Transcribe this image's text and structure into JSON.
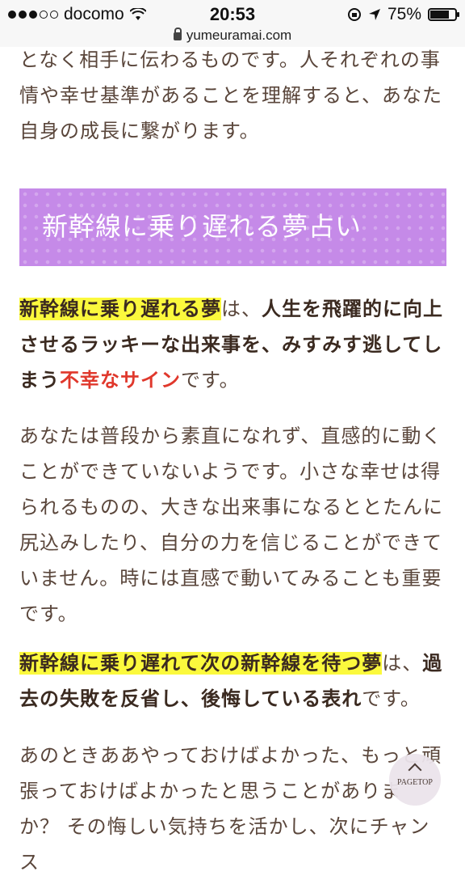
{
  "statusbar": {
    "carrier": "docomo",
    "time": "20:53",
    "battery_percent": "75%",
    "battery_level": 0.75
  },
  "urlbar": {
    "url": "yumeuramai.com"
  },
  "article": {
    "intro_lines": [
      "となく相手に伝わるものです。人それぞれの事",
      "情や幸せ基準があることを理解すると、あなた",
      "自身の成長に繋がります。"
    ],
    "heading": "新幹線に乗り遅れる夢占い",
    "block1": {
      "highlight": "新幹線に乗り遅れる夢",
      "mid": "は、",
      "bold1": "人生を飛躍的に向上",
      "line2": "させるラッキーな出来事を、みすみす逃してし",
      "line3_bold": "まう",
      "red": "不幸なサイン",
      "end": "です。"
    },
    "block2_lines": [
      "あなたは普段から素直になれず、直感的に動く",
      "ことができていないようです。小さな幸せは得",
      "られるものの、大きな出来事になるととたんに",
      "尻込みしたり、自分の力を信じることができて",
      "いません。時には直感で動いてみることも重要",
      "です。"
    ],
    "block3": {
      "highlight": "新幹線に乗り遅れて次の新幹線を待つ夢",
      "mid": "は、",
      "bold1": "過",
      "line2_bold": "去の失敗を反省し、後悔している表れ",
      "end": "です。"
    },
    "block4_lines": [
      "あのときああやっておけばよかった、もっと頑",
      "張っておけばよかったと思うことがありま",
      "か？ その悔しい気持ちを活かし、次にチャンス"
    ]
  },
  "pagetop": {
    "label": "PAGETOP"
  }
}
